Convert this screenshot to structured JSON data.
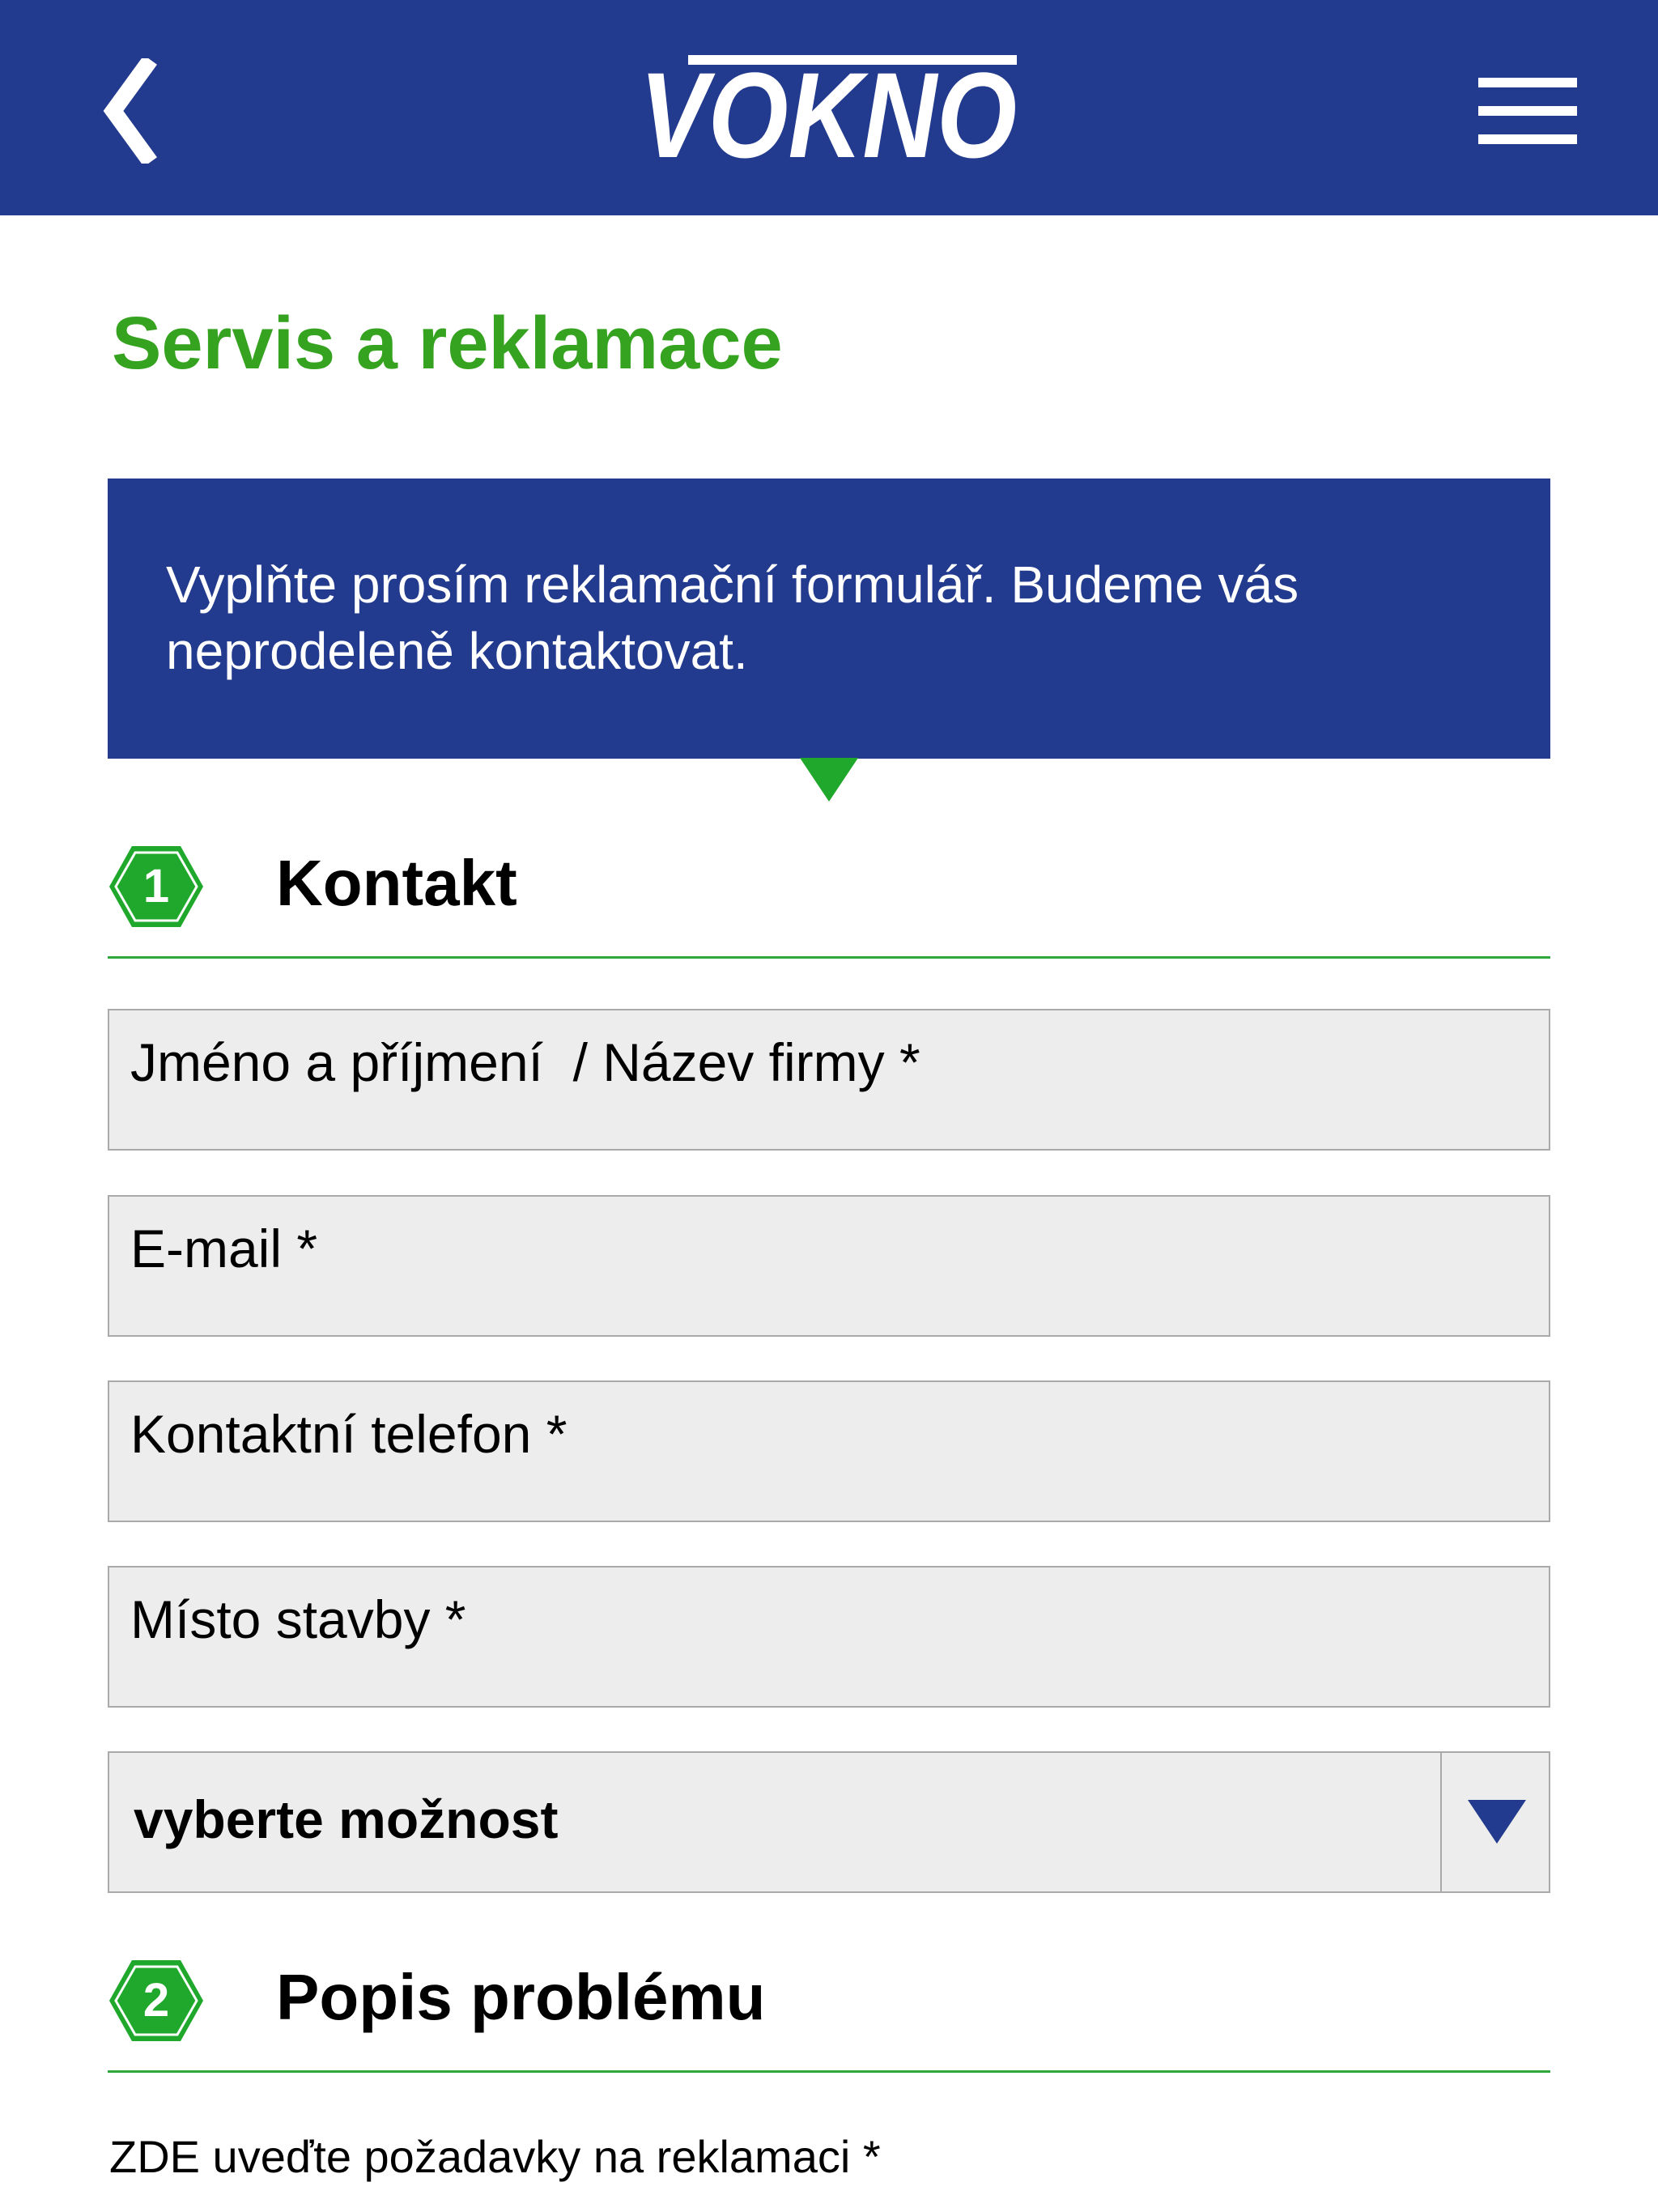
{
  "colors": {
    "brand_blue": "#233b8e",
    "brand_green": "#35a31f",
    "field_bg": "#ededed",
    "field_border": "#a9a9a9"
  },
  "header": {
    "back_icon": "chevron-left-icon",
    "logo_text": "VOKNO",
    "menu_icon": "hamburger-menu-icon"
  },
  "page": {
    "title": "Servis a reklamace"
  },
  "intro": {
    "text": "Vyplňte prosím reklamační formulář. Budeme vás neprodeleně kontaktovat."
  },
  "sections": [
    {
      "number": "1",
      "title": "Kontakt"
    },
    {
      "number": "2",
      "title": "Popis problému"
    }
  ],
  "form": {
    "fields": [
      {
        "placeholder": "Jméno a příjmení  / Název firmy *",
        "value": ""
      },
      {
        "placeholder": "E-mail *",
        "value": ""
      },
      {
        "placeholder": "Kontaktní telefon *",
        "value": ""
      },
      {
        "placeholder": "Místo stavby *",
        "value": ""
      }
    ],
    "select": {
      "selected": "vyberte možnost",
      "icon": "dropdown-triangle-icon"
    },
    "requirements_label": "ZDE uveďte požadavky na reklamaci *"
  }
}
